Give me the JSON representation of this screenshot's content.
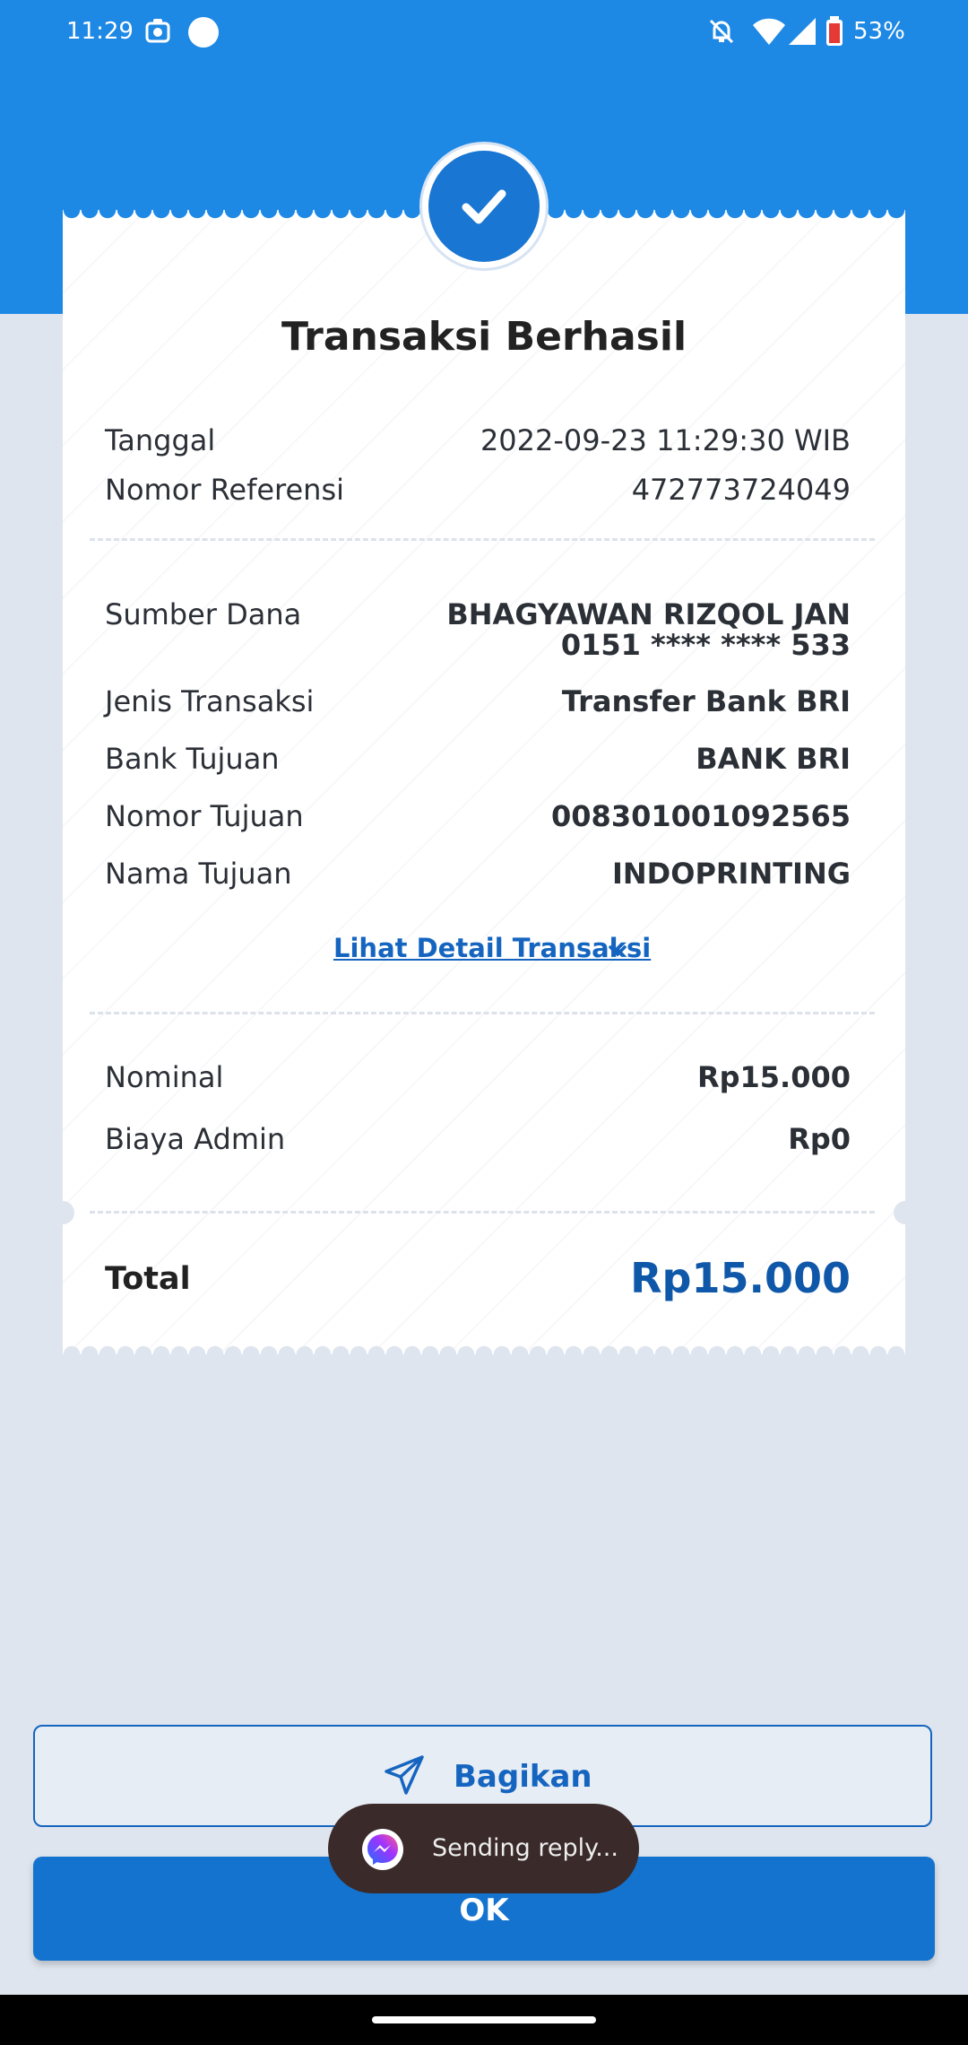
{
  "status_bar": {
    "time": "11:29",
    "battery": "53%",
    "icons": [
      "screenshot-icon",
      "record-dot-icon",
      "mute-icon",
      "wifi-icon",
      "signal-icon",
      "battery-icon"
    ]
  },
  "receipt": {
    "title": "Transaksi Berhasil",
    "tanggal_label": "Tanggal",
    "tanggal_value": "2022-09-23 11:29:30 WIB",
    "ref_label": "Nomor Referensi",
    "ref_value": "472773724049",
    "sumber_label": "Sumber Dana",
    "sumber_name": "BHAGYAWAN RIZQOL JAN",
    "sumber_account": "0151 **** **** 533",
    "jenis_label": "Jenis Transaksi",
    "jenis_value": "Transfer Bank BRI",
    "bank_label": "Bank Tujuan",
    "bank_value": "BANK BRI",
    "nomor_tujuan_label": "Nomor Tujuan",
    "nomor_tujuan_value": "008301001092565",
    "nama_tujuan_label": "Nama Tujuan",
    "nama_tujuan_value": "INDOPRINTING",
    "detail_link": "Lihat Detail Transaksi",
    "nominal_label": "Nominal",
    "nominal_value": "Rp15.000",
    "admin_label": "Biaya Admin",
    "admin_value": "Rp0",
    "total_label": "Total",
    "total_value": "Rp15.000"
  },
  "buttons": {
    "share_label": "Bagikan",
    "ok_label": "OK"
  },
  "toast": {
    "text": "Sending reply..."
  },
  "colors": {
    "brand_blue": "#1e88e5",
    "button_blue": "#1473cf",
    "total_blue": "#0f57a8"
  }
}
